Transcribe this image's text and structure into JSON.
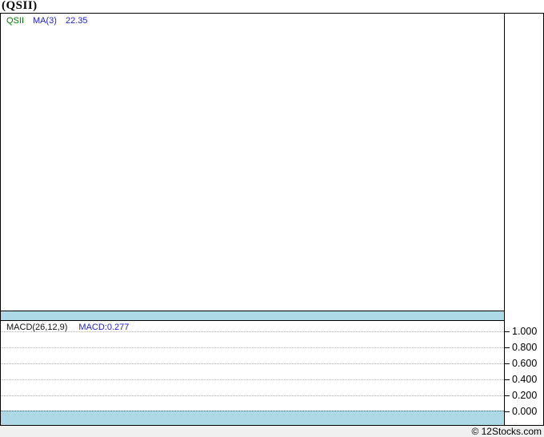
{
  "title": "(QSII)",
  "price_panel": {
    "legend": {
      "ticker": "QSII",
      "ma_label": "MA(3)",
      "ma_value": "22.35"
    }
  },
  "macd_panel": {
    "legend": {
      "indicator": "MACD(26,12,9)",
      "value": "MACD:0.277"
    }
  },
  "axis": {
    "ticks": [
      "1.000",
      "0.800",
      "0.600",
      "0.400",
      "0.200",
      "0.000"
    ]
  },
  "footer": {
    "copyright": "© 12Stocks.com"
  },
  "colors": {
    "ticker_green": "#008000",
    "value_blue": "#2222cc",
    "band_blue": "#add8e6",
    "grid_gray": "#b3b3b3",
    "footer_bg": "#f0f0f0"
  },
  "chart_data": [
    {
      "type": "line",
      "panel": "price",
      "title": "(QSII)",
      "legend": [
        "QSII",
        "MA(3)"
      ],
      "latest_values": {
        "MA(3)": 22.35
      },
      "x": [],
      "series": [
        {
          "name": "QSII",
          "values": []
        },
        {
          "name": "MA(3)",
          "values": []
        }
      ],
      "grid": false,
      "note": "panel rendered empty - no visible price data"
    },
    {
      "type": "line",
      "panel": "MACD",
      "legend": [
        "MACD(26,12,9)"
      ],
      "latest_values": {
        "MACD": 0.277
      },
      "ylim": [
        0.0,
        1.0
      ],
      "yticks": [
        1.0,
        0.8,
        0.6,
        0.4,
        0.2,
        0.0
      ],
      "x": [],
      "series": [
        {
          "name": "MACD",
          "values": []
        }
      ],
      "grid": true,
      "legend_position": "top-left",
      "note": "only dotted gridlines visible - no curve drawn"
    }
  ]
}
